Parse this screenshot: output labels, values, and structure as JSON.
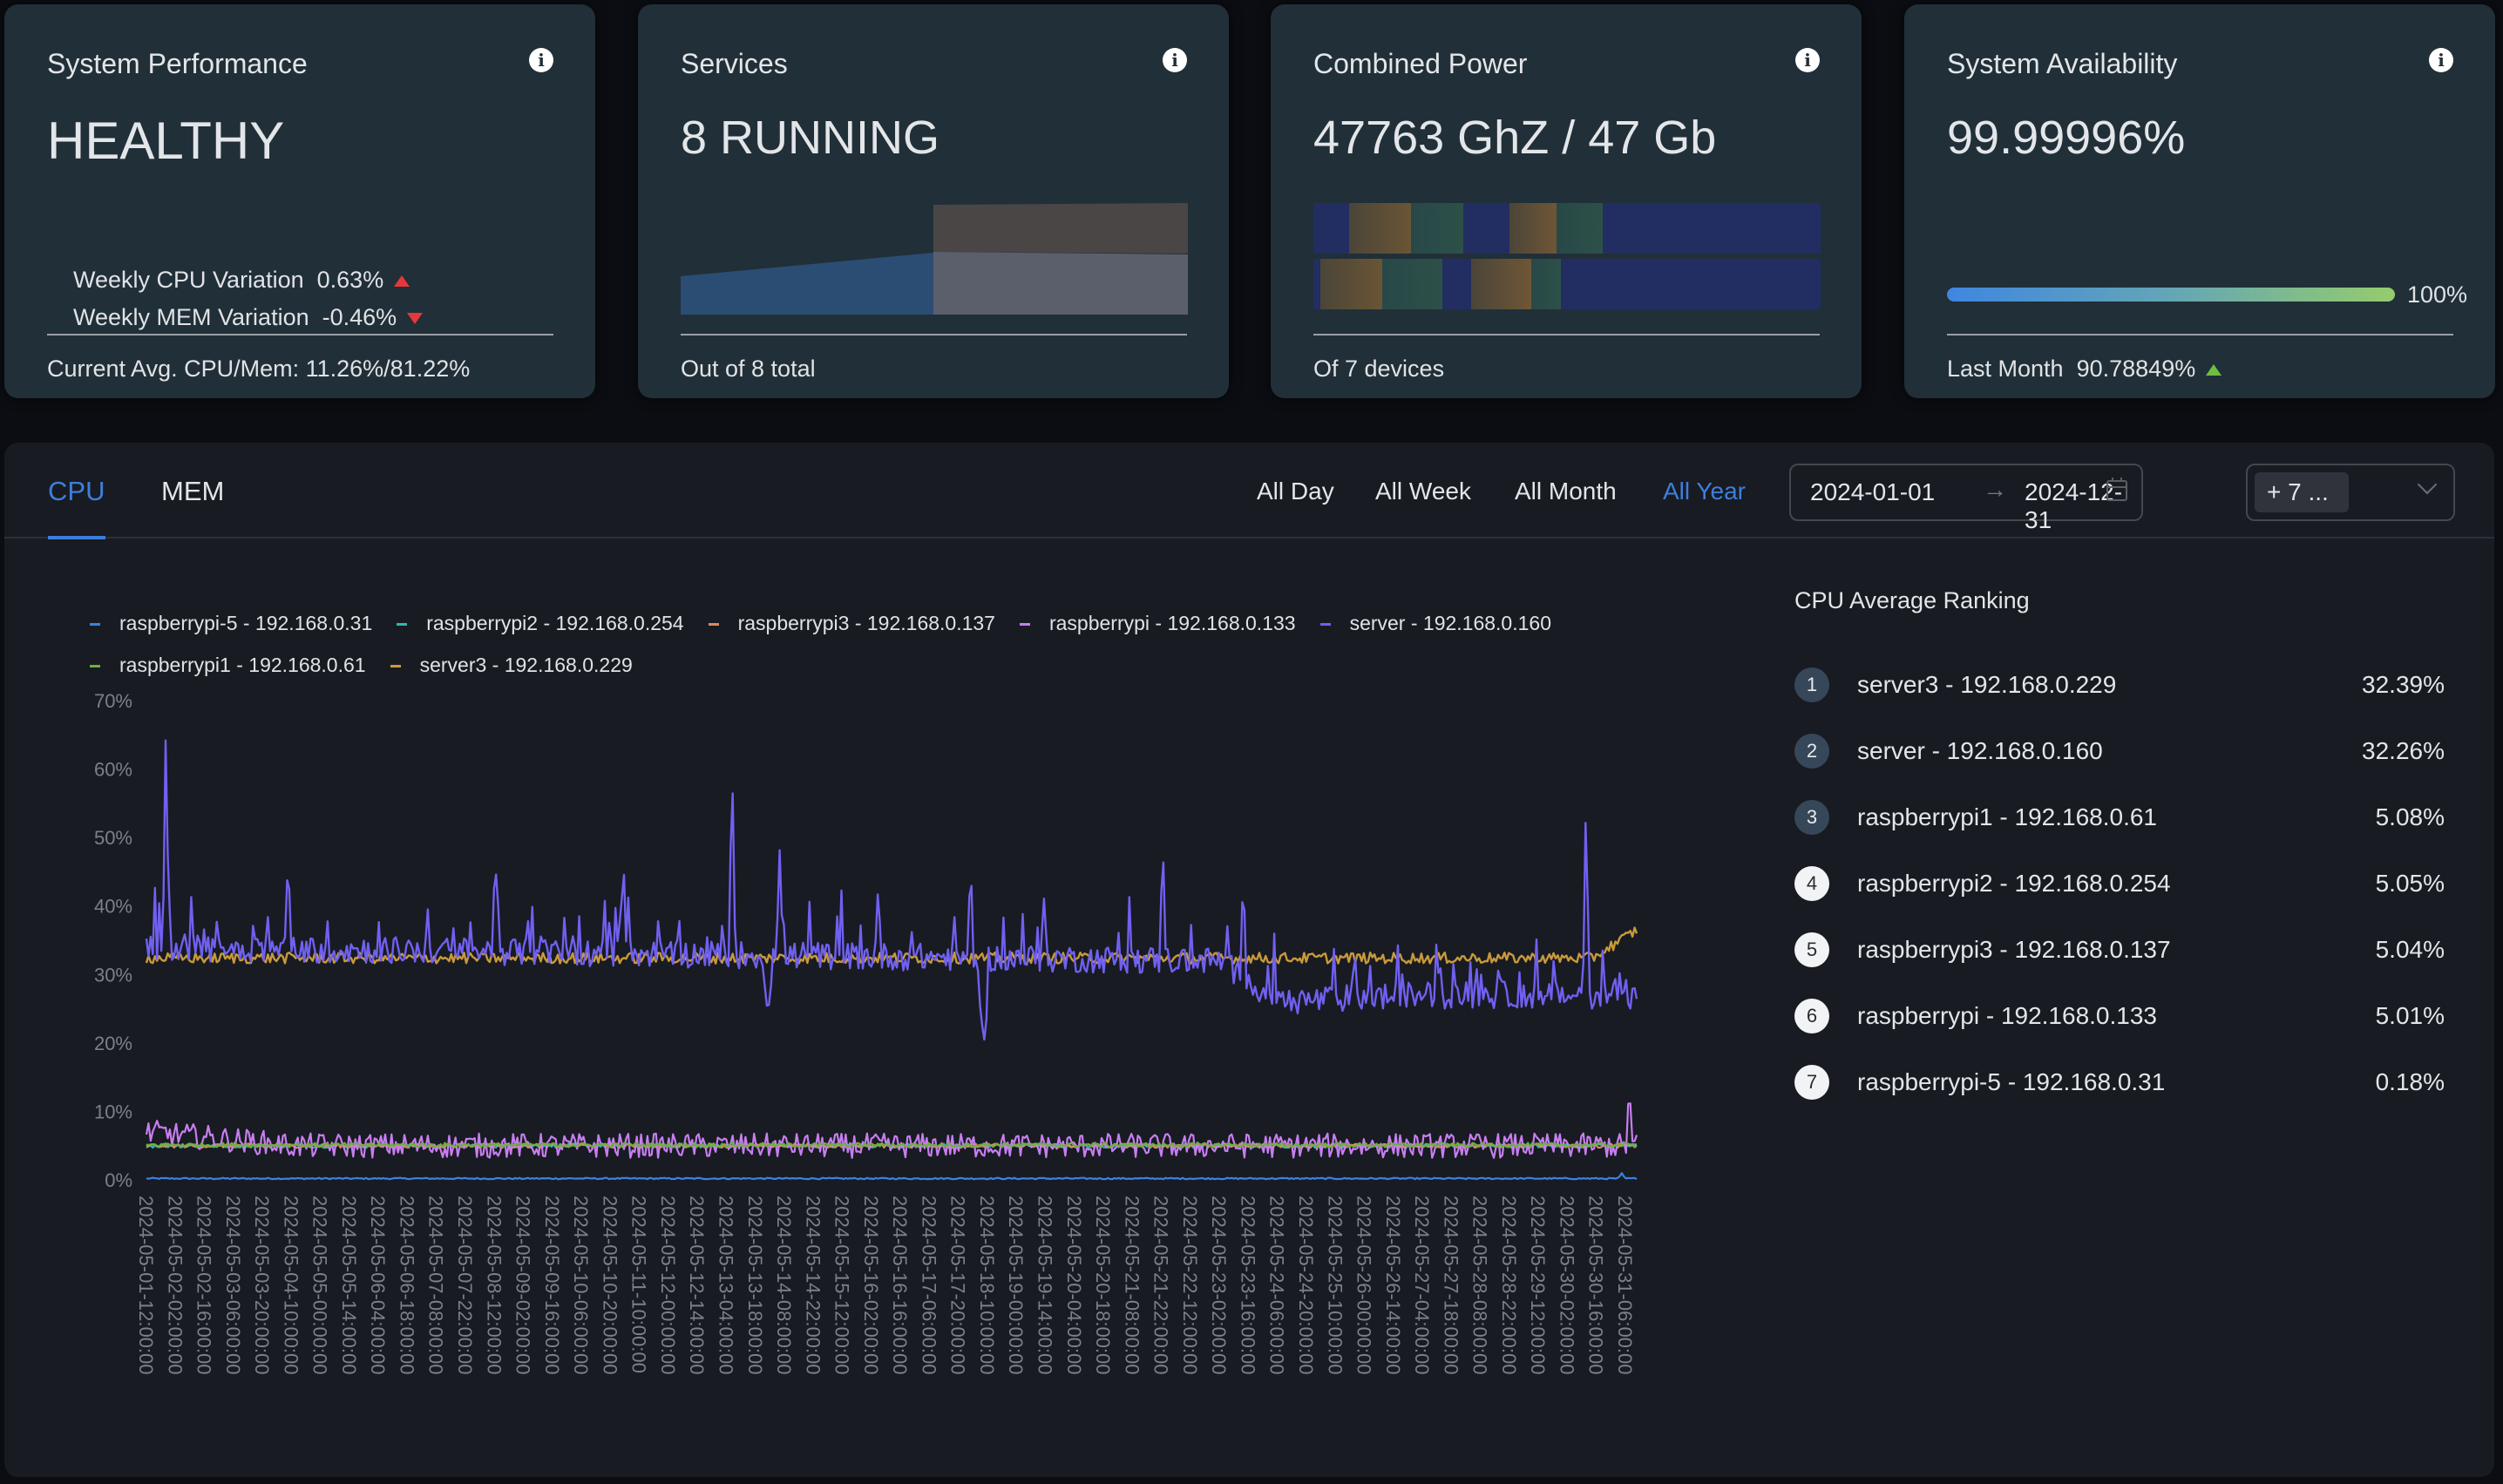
{
  "cards": {
    "performance": {
      "title": "System Performance",
      "status": "HEALTHY",
      "cpu_variation_label": "Weekly CPU Variation",
      "cpu_variation_value": "0.63%",
      "cpu_variation_trend": "up",
      "mem_variation_label": "Weekly MEM Variation",
      "mem_variation_value": "-0.46%",
      "mem_variation_trend": "down",
      "footer": "Current Avg. CPU/Mem: 11.26%/81.22%"
    },
    "services": {
      "title": "Services",
      "value": "8 RUNNING",
      "footer": "Out of 8 total"
    },
    "power": {
      "title": "Combined Power",
      "value": "47763 GhZ / 47 Gb",
      "footer": "Of 7 devices"
    },
    "availability": {
      "title": "System Availability",
      "value": "99.99996%",
      "progress_percent": 100,
      "progress_label": "100%",
      "footer_label": "Last Month",
      "footer_value": "90.78849%",
      "footer_trend": "up"
    }
  },
  "panel": {
    "tabs": [
      {
        "label": "CPU",
        "active": true
      },
      {
        "label": "MEM",
        "active": false
      }
    ],
    "ranges": [
      {
        "label": "All Day",
        "active": false
      },
      {
        "label": "All Week",
        "active": false
      },
      {
        "label": "All Month",
        "active": false
      },
      {
        "label": "All Year",
        "active": true
      }
    ],
    "date_start": "2024-01-01",
    "date_end": "2024-12-31",
    "date_arrow": "→",
    "host_select_tag": "+ 7 ..."
  },
  "ranking": {
    "title": "CPU Average Ranking",
    "items": [
      {
        "rank": "1",
        "label": "server3 - 192.168.0.229",
        "value": "32.39%"
      },
      {
        "rank": "2",
        "label": "server - 192.168.0.160",
        "value": "32.26%"
      },
      {
        "rank": "3",
        "label": "raspberrypi1 - 192.168.0.61",
        "value": "5.08%"
      },
      {
        "rank": "4",
        "label": "raspberrypi2 - 192.168.0.254",
        "value": "5.05%"
      },
      {
        "rank": "5",
        "label": "raspberrypi3 - 192.168.0.137",
        "value": "5.04%"
      },
      {
        "rank": "6",
        "label": "raspberrypi - 192.168.0.133",
        "value": "5.01%"
      },
      {
        "rank": "7",
        "label": "raspberrypi-5 - 192.168.0.31",
        "value": "0.18%"
      }
    ]
  },
  "colors": {
    "accent": "#3d7fdc",
    "trend_down_red": "#e5383b",
    "trend_up_red": "#e5383b",
    "trend_up_green": "#6fbf3f"
  },
  "chart_data": {
    "type": "line",
    "title": "",
    "xlabel": "",
    "ylabel": "",
    "ylim": [
      0,
      70
    ],
    "y_ticks": [
      "0%",
      "10%",
      "20%",
      "30%",
      "40%",
      "50%",
      "60%",
      "70%"
    ],
    "grid": false,
    "legend_position": "top-left",
    "x_start": "2024-05-01 12:00:00",
    "x_step_hours": 14,
    "x_tick_labels": [
      "2024-05-01-12:00:00",
      "2024-05-02-02:00:00",
      "2024-05-02-16:00:00",
      "2024-05-03-06:00:00",
      "2024-05-03-20:00:00",
      "2024-05-04-10:00:00",
      "2024-05-05-00:00:00",
      "2024-05-05-14:00:00",
      "2024-05-06-04:00:00",
      "2024-05-06-18:00:00",
      "2024-05-07-08:00:00",
      "2024-05-07-22:00:00",
      "2024-05-08-12:00:00",
      "2024-05-09-02:00:00",
      "2024-05-09-16:00:00",
      "2024-05-10-06:00:00",
      "2024-05-10-20:00:00",
      "2024-05-11-10:00:00",
      "2024-05-12-00:00:00",
      "2024-05-12-14:00:00",
      "2024-05-13-04:00:00",
      "2024-05-13-18:00:00",
      "2024-05-14-08:00:00",
      "2024-05-14-22:00:00",
      "2024-05-15-12:00:00",
      "2024-05-16-02:00:00",
      "2024-05-16-16:00:00",
      "2024-05-17-06:00:00",
      "2024-05-17-20:00:00",
      "2024-05-18-10:00:00",
      "2024-05-19-00:00:00",
      "2024-05-19-14:00:00",
      "2024-05-20-04:00:00",
      "2024-05-20-18:00:00",
      "2024-05-21-08:00:00",
      "2024-05-21-22:00:00",
      "2024-05-22-12:00:00",
      "2024-05-23-02:00:00",
      "2024-05-23-16:00:00",
      "2024-05-24-06:00:00",
      "2024-05-24-20:00:00",
      "2024-05-25-10:00:00",
      "2024-05-26-00:00:00",
      "2024-05-26-14:00:00",
      "2024-05-27-04:00:00",
      "2024-05-27-18:00:00",
      "2024-05-28-08:00:00",
      "2024-05-28-22:00:00",
      "2024-05-29-12:00:00",
      "2024-05-30-02:00:00",
      "2024-05-30-16:00:00",
      "2024-05-31-06:00:00"
    ],
    "series": [
      {
        "name": "raspberrypi-5 - 192.168.0.31",
        "color": "#3b82e0",
        "baseline": 0.2,
        "noise": 0.1,
        "keypoints": [
          [
            0,
            0.2
          ],
          [
            0.5,
            0.2
          ],
          [
            1,
            0.2
          ]
        ],
        "spikes": [
          [
            0.99,
            1.0
          ]
        ]
      },
      {
        "name": "raspberrypi2 - 192.168.0.254",
        "color": "#36b5b0",
        "baseline": 5.0,
        "noise": 0.3,
        "keypoints": [
          [
            0,
            5.0
          ],
          [
            1,
            5.0
          ]
        ],
        "spikes": []
      },
      {
        "name": "raspberrypi3 - 192.168.0.137",
        "color": "#d98c5f",
        "baseline": 5.0,
        "noise": 0.3,
        "keypoints": [
          [
            0,
            5.0
          ],
          [
            1,
            5.0
          ]
        ],
        "spikes": []
      },
      {
        "name": "raspberrypi - 192.168.0.133",
        "color": "#c77ef0",
        "baseline": 5.0,
        "noise": 1.8,
        "keypoints": [
          [
            0,
            7.0
          ],
          [
            0.05,
            6.0
          ],
          [
            0.1,
            5.0
          ],
          [
            1,
            5.0
          ]
        ],
        "spikes": [
          [
            0.995,
            14.0
          ]
        ]
      },
      {
        "name": "server - 192.168.0.160",
        "color": "#7060f0",
        "baseline": 32.0,
        "noise": 2.0,
        "keypoints": [
          [
            0,
            34
          ],
          [
            0.72,
            32
          ],
          [
            0.76,
            26
          ],
          [
            0.85,
            27
          ],
          [
            1,
            27
          ]
        ],
        "spikes": [
          [
            0.013,
            66
          ],
          [
            0.095,
            47
          ],
          [
            0.234,
            49
          ],
          [
            0.32,
            48
          ],
          [
            0.393,
            62
          ],
          [
            0.425,
            49
          ],
          [
            0.491,
            43
          ],
          [
            0.553,
            47
          ],
          [
            0.602,
            42
          ],
          [
            0.682,
            50
          ],
          [
            0.736,
            46
          ],
          [
            0.966,
            56
          ]
        ],
        "dips": [
          [
            0.562,
            20
          ],
          [
            0.417,
            24
          ]
        ]
      },
      {
        "name": "raspberrypi1 - 192.168.0.61",
        "color": "#6fae3f",
        "baseline": 5.1,
        "noise": 0.3,
        "keypoints": [
          [
            0,
            5.1
          ],
          [
            1,
            5.1
          ]
        ],
        "spikes": []
      },
      {
        "name": "server3 - 192.168.0.229",
        "color": "#c99a3a",
        "baseline": 32.4,
        "noise": 0.8,
        "keypoints": [
          [
            0,
            32.4
          ],
          [
            0.97,
            32.4
          ],
          [
            1,
            36.5
          ]
        ],
        "spikes": []
      }
    ]
  }
}
